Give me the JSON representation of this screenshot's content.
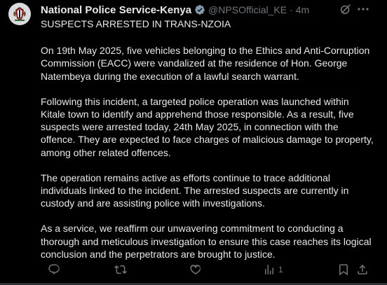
{
  "post": {
    "author_name": "National Police Service-Kenya",
    "handle": "@NPSOfficial_KE",
    "separator": "·",
    "time": "4m",
    "headline": "SUSPECTS ARRESTED IN TRANS-NZOIA",
    "paragraphs": [
      "On 19th May 2025, five vehicles belonging to the Ethics and Anti-Corruption Commission (EACC) were vandalized at the residence of Hon. George Natembeya during the execution of a lawful search warrant.",
      "Following this incident, a targeted police operation was launched within Kitale town to identify and apprehend those responsible. As a result, five suspects were arrested today, 24th May 2025, in connection with the offence. They are expected to face charges of malicious damage to property, among other related offences.",
      "The operation remains active as efforts continue to trace additional individuals linked to the incident. The arrested suspects are currently in custody and are assisting police with investigations.",
      "As a service, we reaffirm our unwavering commitment to conducting a thorough and meticulous investigation to ensure this case reaches its logical conclusion and the perpetrators are brought to justice."
    ]
  },
  "actions": {
    "views_count": "1"
  },
  "icons": {
    "verified": "verified-badge-icon",
    "grok": "grok-icon",
    "more": "more-options-icon",
    "reply": "reply-icon",
    "repost": "repost-icon",
    "like": "like-icon",
    "views": "views-icon",
    "bookmark": "bookmark-icon",
    "share": "share-icon"
  },
  "colors": {
    "background": "#000000",
    "text": "#e7e9ea",
    "secondary": "#71767b",
    "verified": "#829aab"
  }
}
